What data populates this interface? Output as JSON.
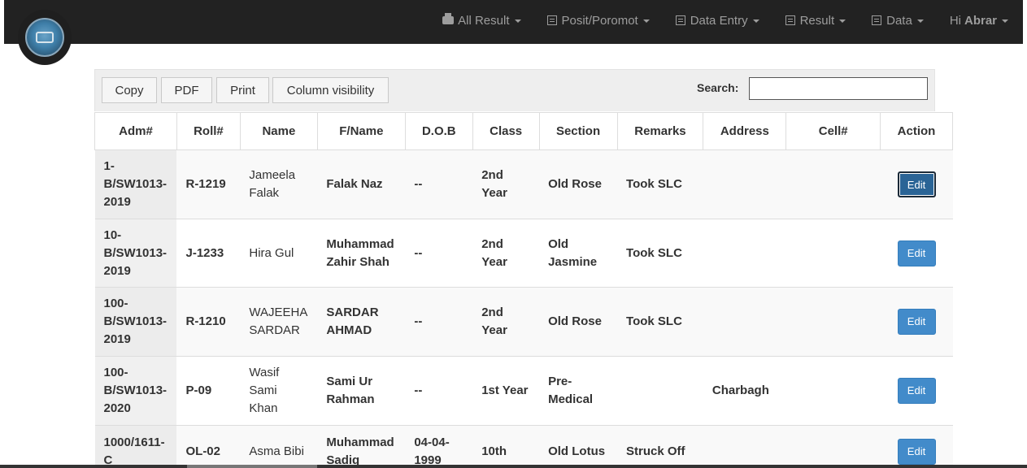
{
  "nav": {
    "items": [
      {
        "label": "All Result",
        "icon": "printer-icon"
      },
      {
        "label": "Posit/Poromot",
        "icon": "list-icon"
      },
      {
        "label": "Data Entry",
        "icon": "list-icon"
      },
      {
        "label": "Result",
        "icon": "list-icon"
      },
      {
        "label": "Data",
        "icon": "list-icon"
      }
    ],
    "greeting": "Hi",
    "user": "Abrar"
  },
  "toolbar": {
    "copy_label": "Copy",
    "pdf_label": "PDF",
    "print_label": "Print",
    "colvis_label": "Column visibility",
    "search_label": "Search:",
    "search_value": ""
  },
  "table": {
    "headers": [
      "Adm#",
      "Roll#",
      "Name",
      "F/Name",
      "D.O.B",
      "Class",
      "Section",
      "Remarks",
      "Address",
      "Cell#",
      "Action"
    ],
    "rows": [
      {
        "adm": "1-B/SW1013-2019",
        "roll": "R-1219",
        "name": "Jameela Falak",
        "fname": "Falak Naz",
        "dob": "--",
        "class": "2nd Year",
        "section": "Old Rose",
        "remarks": "Took SLC",
        "address": "",
        "cell": "",
        "action": "Edit"
      },
      {
        "adm": "10-B/SW1013-2019",
        "roll": "J-1233",
        "name": "Hira Gul",
        "fname": "Muhammad Zahir Shah",
        "dob": "--",
        "class": "2nd Year",
        "section": "Old Jasmine",
        "remarks": "Took SLC",
        "address": "",
        "cell": "",
        "action": "Edit"
      },
      {
        "adm": "100-B/SW1013-2019",
        "roll": "R-1210",
        "name": "WAJEEHA SARDAR",
        "fname": "SARDAR AHMAD",
        "dob": "--",
        "class": "2nd Year",
        "section": "Old Rose",
        "remarks": "Took SLC",
        "address": "",
        "cell": "",
        "action": "Edit"
      },
      {
        "adm": "100-B/SW1013-2020",
        "roll": "P-09",
        "name": "Wasif Sami Khan",
        "fname": "Sami Ur Rahman",
        "dob": "--",
        "class": "1st Year",
        "section": "Pre-Medical",
        "remarks": "",
        "address": "Charbagh",
        "cell": "",
        "action": "Edit"
      },
      {
        "adm": "1000/1611-C",
        "roll": "OL-02",
        "name": "Asma Bibi",
        "fname": "Muhammad Sadiq",
        "dob": "04-04-1999",
        "class": "10th",
        "section": "Old Lotus",
        "remarks": "Struck Off",
        "address": "",
        "cell": "",
        "action": "Edit"
      }
    ]
  }
}
